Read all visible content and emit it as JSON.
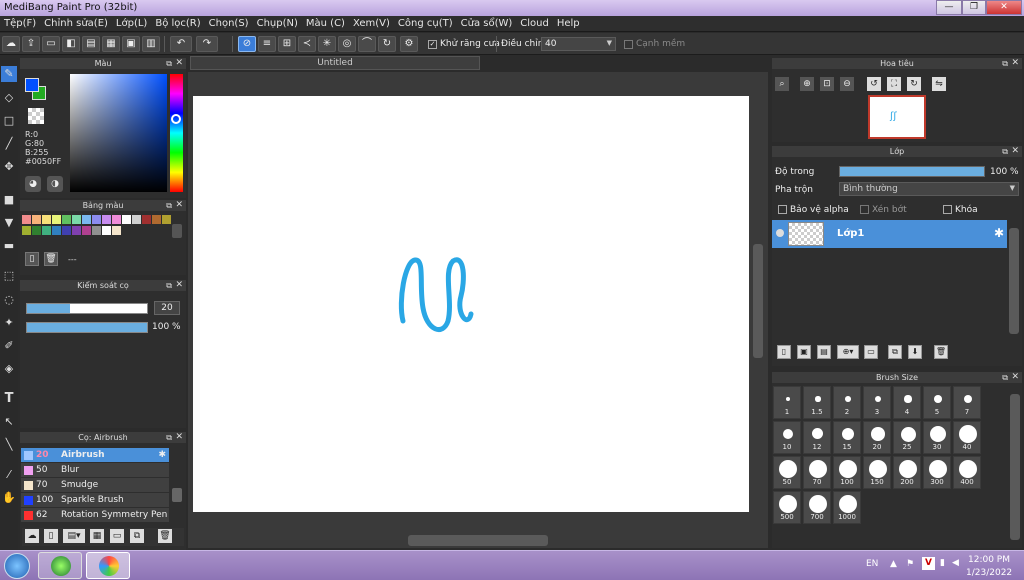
{
  "window": {
    "title": "MediBang Paint Pro (32bit)",
    "min": "—",
    "max": "❐",
    "close": "✕"
  },
  "menu": [
    "Tệp(F)",
    "Chỉnh sửa(E)",
    "Lớp(L)",
    "Bộ lọc(R)",
    "Chọn(S)",
    "Chụp(N)",
    "Màu (C)",
    "Xem(V)",
    "Công cụ(T)",
    "Cửa sổ(W)",
    "Cloud",
    "Help"
  ],
  "toolbar": {
    "antialias_label": "Khử răng cưa",
    "adjust_label": "Điều chỉnh",
    "adjust_value": "40",
    "snap_label": "Cạnh mềm"
  },
  "canvas_tab": "Untitled",
  "color_panel": {
    "title": "Màu",
    "r": "R:0",
    "g": "G:80",
    "b": "B:255",
    "hex": "#0050FF",
    "primary": "#0050ff",
    "secondary": "#22aa22"
  },
  "palette_panel": {
    "title": "Bảng màu",
    "dashes": "---",
    "swatches": [
      "#f28c8c",
      "#f7b27a",
      "#f7e07a",
      "#e8f57a",
      "#60c060",
      "#7ad9a8",
      "#7ab8f0",
      "#8c8cf0",
      "#c88cf0",
      "#f08cd9",
      "#ffffff",
      "#d0d0d0",
      "#a03030",
      "#b06a30",
      "#b0a030",
      "#a0b030",
      "#308030",
      "#40b080",
      "#3080c0",
      "#4040b0",
      "#8040b0",
      "#b04090",
      "#909090",
      "#ffffff",
      "#f5e6cc"
    ]
  },
  "brush_control": {
    "title": "Kiểm soát cọ",
    "size_value": "20",
    "opacity_label": "100 %",
    "size_fraction": 0.36,
    "opacity_fraction": 1.0
  },
  "brush_panel": {
    "title": "Cọ: Airbrush",
    "items": [
      {
        "size": "20",
        "name": "Airbrush",
        "color": "#a0c8ff"
      },
      {
        "size": "50",
        "name": "Blur",
        "color": "#f0a0f0"
      },
      {
        "size": "70",
        "name": "Smudge",
        "color": "#f5e6cc"
      },
      {
        "size": "100",
        "name": "Sparkle Brush",
        "color": "#2040ff"
      },
      {
        "size": "62",
        "name": "Rotation Symmetry Pen",
        "color": "#ff3030"
      }
    ]
  },
  "navigator": {
    "title": "Hoa tiêu"
  },
  "layer_panel": {
    "title": "Lớp",
    "opacity_label": "Độ trong",
    "opacity_value": "100 %",
    "blend_label": "Pha trộn",
    "blend_value": "Bình thường",
    "protect_alpha": "Bảo vệ alpha",
    "clip": "Xén bớt",
    "lock": "Khóa",
    "layer_name": "Lớp1",
    "opacity_fraction": 1.0
  },
  "brush_size": {
    "title": "Brush Size",
    "sizes": [
      "1",
      "1.5",
      "2",
      "3",
      "4",
      "5",
      "7",
      "10",
      "12",
      "15",
      "20",
      "25",
      "30",
      "40",
      "50",
      "70",
      "100",
      "150",
      "200",
      "300",
      "400",
      "500",
      "700",
      "1000"
    ]
  },
  "taskbar": {
    "lang": "EN",
    "time": "12:00 PM",
    "date": "1/23/2022"
  }
}
